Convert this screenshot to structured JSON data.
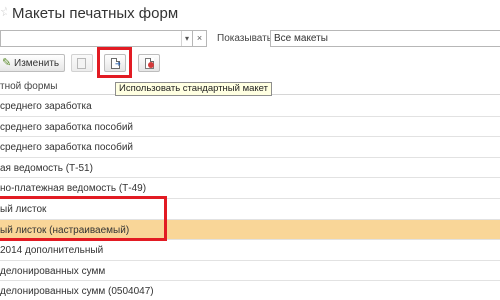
{
  "window": {
    "title": "Макеты печатных форм"
  },
  "filter": {
    "search_value": "",
    "show_label": "Показывать:",
    "show_value": "Все макеты"
  },
  "toolbar": {
    "edit_label": "Изменить",
    "tooltip": "Использовать стандартный макет"
  },
  "table": {
    "column_header": "тной формы",
    "rows": [
      {
        "label": "среднего заработка",
        "selected": false
      },
      {
        "label": "среднего заработка пособий",
        "selected": false
      },
      {
        "label": "среднего заработка пособий",
        "selected": false
      },
      {
        "label": "ая ведомость (Т-51)",
        "selected": false
      },
      {
        "label": "но-платежная ведомость (Т-49)",
        "selected": false
      },
      {
        "label": "ый листок",
        "selected": false
      },
      {
        "label": "ый листок (настраиваемый)",
        "selected": true
      },
      {
        "label": "2014 дополнительный",
        "selected": false
      },
      {
        "label": "делонированных сумм",
        "selected": false
      },
      {
        "label": "делонированных сумм (0504047)",
        "selected": false
      }
    ]
  },
  "colors": {
    "selection": "#f9d698",
    "highlight_frame": "#e21b23",
    "tooltip_bg": "#ffffe1"
  }
}
